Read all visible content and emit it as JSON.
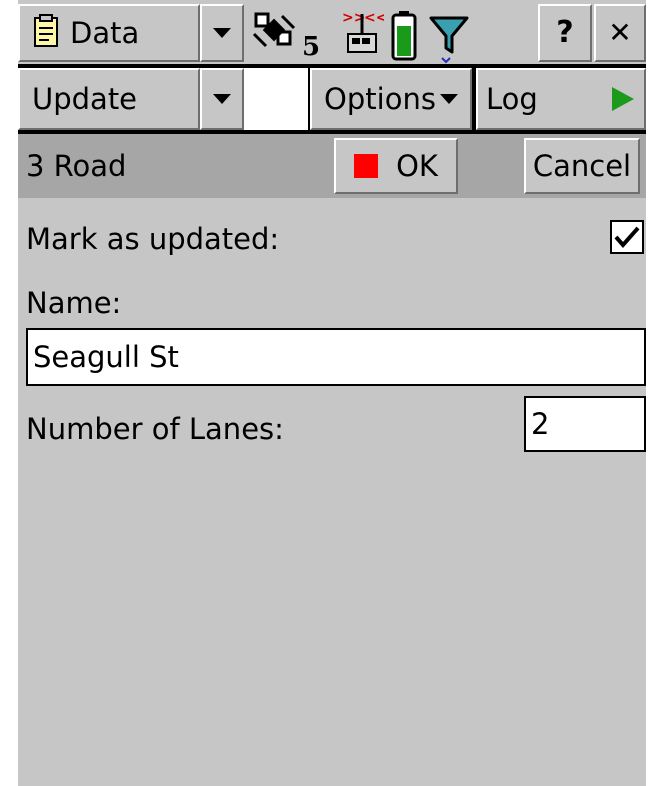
{
  "titlebar": {
    "app_menu_label": "Data",
    "satellite_count": "5",
    "help_label": "?",
    "close_label": "✕"
  },
  "toolbar": {
    "update_label": "Update",
    "options_label": "Options",
    "log_label": "Log"
  },
  "form_header": {
    "feature_title": "3 Road",
    "ok_label": "OK",
    "cancel_label": "Cancel"
  },
  "form": {
    "mark_updated_label": "Mark as updated:",
    "mark_updated_checked": true,
    "name_label": "Name:",
    "name_value": "Seagull St",
    "lanes_label": "Number of Lanes:",
    "lanes_value": "2"
  },
  "colors": {
    "surface": "#c6c6c6",
    "header_band": "#a6a6a6",
    "ok_marker": "#ff0000",
    "play_arrow": "#1c9a1c",
    "battery_level": "#1a9a1a",
    "satellite_icon": "#d40000"
  }
}
